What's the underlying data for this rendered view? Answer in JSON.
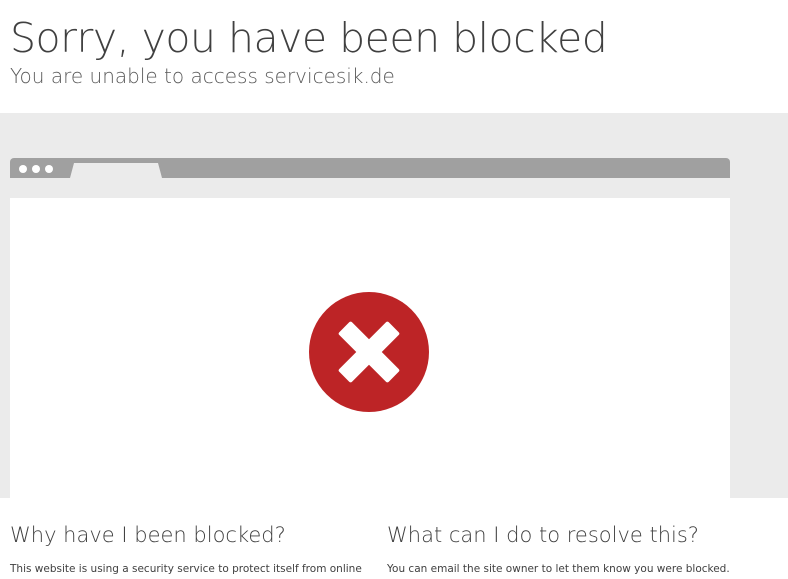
{
  "header": {
    "title": "Sorry, you have been blocked",
    "subtitle": "You are unable to access servicesik.de"
  },
  "colors": {
    "stage_bg": "#ebebeb",
    "browser_bar": "#a0a0a0",
    "tab": "#ebebeb",
    "error_red": "#bd2426",
    "text": "#404040"
  },
  "icons": {
    "browser_dots": "window-dots-icon",
    "blocked": "error-x-circle-icon"
  },
  "sections": {
    "why": {
      "heading": "Why have I been blocked?",
      "body": "This website is using a security service to protect itself from online"
    },
    "resolve": {
      "heading": "What can I do to resolve this?",
      "body": "You can email the site owner to let them know you were blocked."
    }
  }
}
